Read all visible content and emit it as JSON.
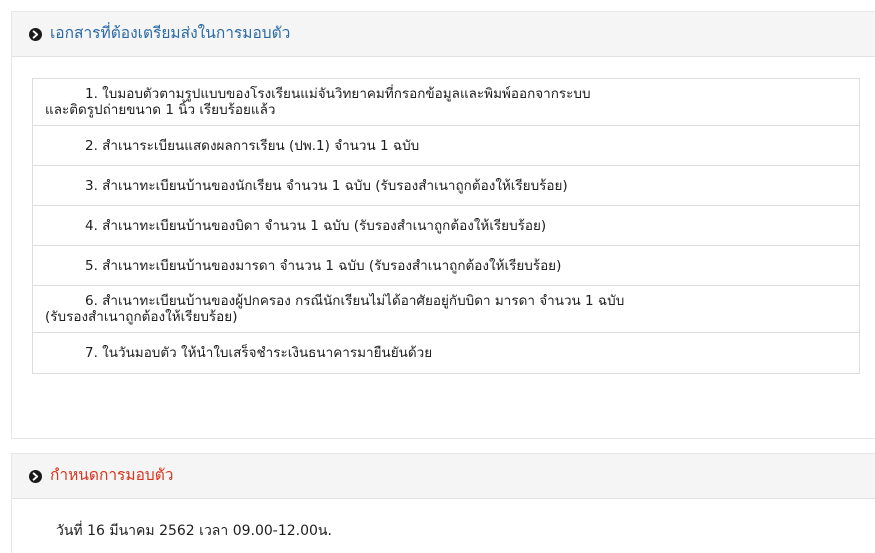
{
  "documents_section": {
    "icon": "circle-arrow-right-icon",
    "title": "เอกสารที่ต้องเตรียมส่งในการมอบตัว",
    "title_color": "#2a6aa6",
    "items": [
      {
        "line1": "1. ใบมอบตัวตามรูปแบบของโรงเรียนแม่จันวิทยาคมที่กรอกข้อมูลและพิมพ์ออกจากระบบ",
        "line2": "และติดรูปถ่ายขนาด 1 นิ้ว เรียบร้อยแล้ว"
      },
      {
        "line1": "2. สำเนาระเบียนแสดงผลการเรียน (ปพ.1) จำนวน 1 ฉบับ"
      },
      {
        "line1": "3. สำเนาทะเบียนบ้านของนักเรียน จำนวน 1 ฉบับ (รับรองสำเนาถูกต้องให้เรียบร้อย)"
      },
      {
        "line1": "4. สำเนาทะเบียนบ้านของบิดา จำนวน 1 ฉบับ (รับรองสำเนาถูกต้องให้เรียบร้อย)"
      },
      {
        "line1": "5. สำเนาทะเบียนบ้านของมารดา จำนวน 1 ฉบับ (รับรองสำเนาถูกต้องให้เรียบร้อย)"
      },
      {
        "line1": "6. สำเนาทะเบียนบ้านของผู้ปกครอง กรณีนักเรียนไม่ได้อาศัยอยู่กับบิดา มารดา จำนวน 1 ฉบับ",
        "line2": "(รับรองสำเนาถูกต้องให้เรียบร้อย)"
      },
      {
        "line1": "7. ในวันมอบตัว ให้นำใบเสร็จชำระเงินธนาคารมายืนยันด้วย"
      }
    ]
  },
  "schedule_section": {
    "icon": "circle-arrow-right-icon",
    "title": "กำหนดการมอบตัว",
    "title_color": "#d9341b",
    "text": "วันที่ 16 มีนาคม 2562 เวลา 09.00-12.00น."
  }
}
